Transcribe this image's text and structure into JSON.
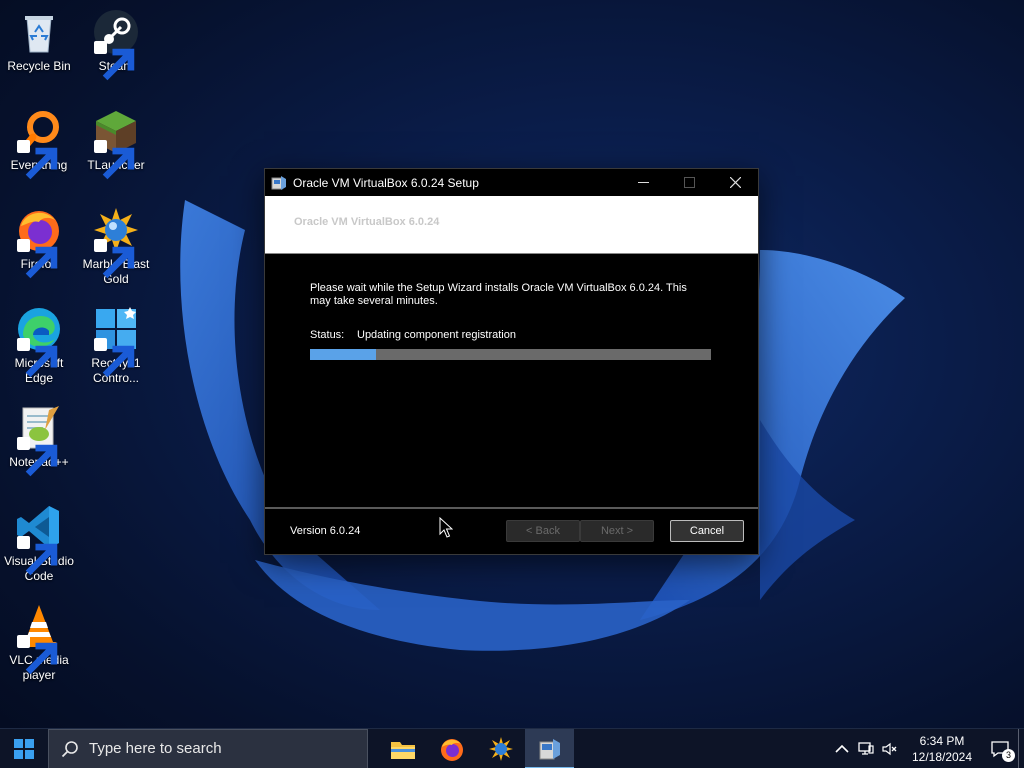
{
  "desktop": {
    "icons": [
      {
        "label": "Recycle Bin",
        "icon": "recycle-bin-icon"
      },
      {
        "label": "Steam",
        "icon": "steam-icon"
      },
      {
        "label": "Everything",
        "icon": "everything-search-icon"
      },
      {
        "label": "TLauncher",
        "icon": "tlauncher-icon"
      },
      {
        "label": "Firefox",
        "icon": "firefox-icon"
      },
      {
        "label": "Marble Blast Gold",
        "icon": "marble-blast-icon"
      },
      {
        "label": "Microsoft Edge",
        "icon": "edge-icon"
      },
      {
        "label": "Rectify11 Contro...",
        "icon": "rectify11-icon"
      },
      {
        "label": "Notepad++",
        "icon": "notepadpp-icon"
      },
      {
        "label": "Visual Studio Code",
        "icon": "vscode-icon"
      },
      {
        "label": "VLC media player",
        "icon": "vlc-icon"
      }
    ]
  },
  "dialog": {
    "title": "Oracle VM VirtualBox 6.0.24 Setup",
    "banner_title": "Oracle VM VirtualBox 6.0.24",
    "message": "Please wait while the Setup Wizard installs Oracle VM VirtualBox 6.0.24. This may take several minutes.",
    "status_label": "Status:",
    "status_value": "Updating component registration",
    "progress_percent": 16.5,
    "version": "Version 6.0.24",
    "buttons": {
      "back": "< Back",
      "next": "Next >",
      "cancel": "Cancel"
    }
  },
  "taskbar": {
    "search_placeholder": "Type here to search",
    "apps": [
      "file-explorer-icon",
      "firefox-icon",
      "marble-blast-icon",
      "virtualbox-setup-icon"
    ],
    "time": "6:34 PM",
    "date": "12/18/2024",
    "notification_count": "3"
  },
  "colors": {
    "progress_fill": "#5aa2e8",
    "progress_track": "#6a6a6a",
    "taskbar": "#0d1427"
  }
}
